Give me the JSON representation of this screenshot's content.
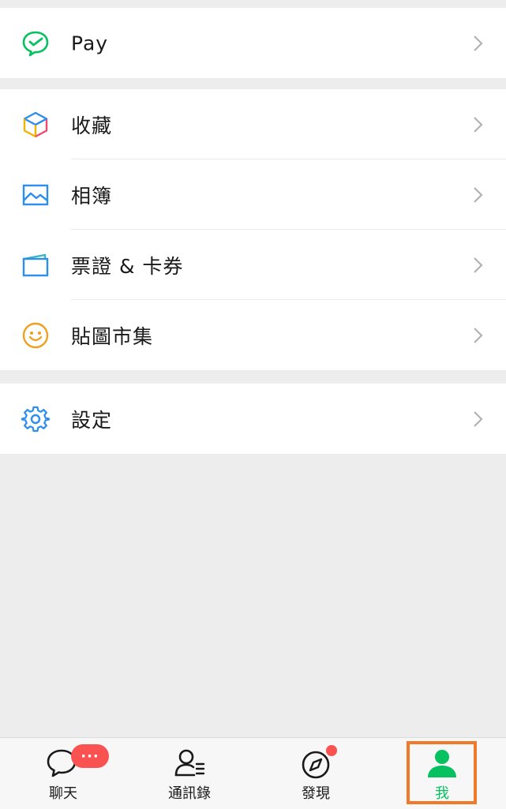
{
  "menu": {
    "pay": {
      "label": "Pay",
      "icon": "wechat-pay-icon"
    },
    "items": [
      {
        "label": "收藏",
        "icon": "favorites-cube-icon"
      },
      {
        "label": "相簿",
        "icon": "album-picture-icon"
      },
      {
        "label": "票證 & 卡券",
        "icon": "cards-wallet-icon"
      },
      {
        "label": "貼圖市集",
        "icon": "sticker-smile-icon"
      }
    ],
    "settings": {
      "label": "設定",
      "icon": "gear-icon"
    }
  },
  "tabbar": {
    "tabs": [
      {
        "label": "聊天",
        "icon": "chat-bubble-icon",
        "badge": "···"
      },
      {
        "label": "通訊錄",
        "icon": "contacts-icon"
      },
      {
        "label": "發現",
        "icon": "compass-icon"
      },
      {
        "label": "我",
        "icon": "person-icon",
        "active": true
      }
    ]
  },
  "colors": {
    "accent": "#07c160",
    "badge": "#fa5151",
    "highlight": "#f07a2a",
    "background": "#ededed"
  }
}
